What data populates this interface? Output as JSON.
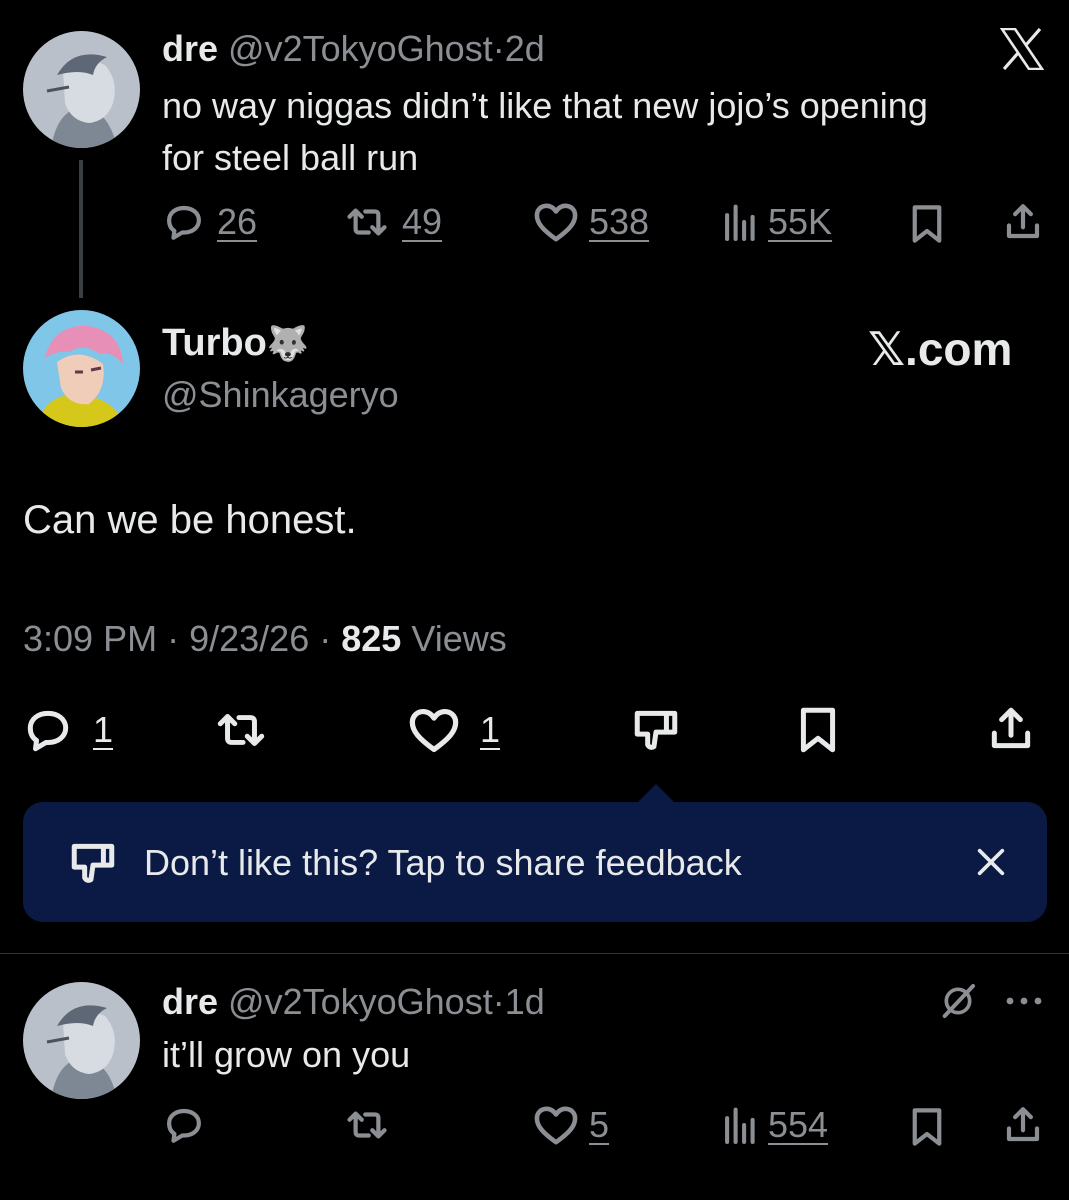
{
  "quoted_post": {
    "author_name": "dre",
    "handle": "@v2TokyoGhost",
    "separator": "·",
    "age": "2d",
    "text_line1": "no way niggas didn’t like that new jojo’s opening",
    "text_line2": "for steel ball run",
    "replies": "26",
    "reposts": "49",
    "likes": "538",
    "views": "55K",
    "platform_logo": "X"
  },
  "main_post": {
    "author_name": "Turbo",
    "author_emoji": "🐺",
    "handle": "@Shinkageryo",
    "watermark": "𝕏.com",
    "text": "Can we be honest.",
    "time": "3:09 PM",
    "date": "9/23/26",
    "dot": "·",
    "views_count": "825",
    "views_label": "Views",
    "replies": "1",
    "likes": "1"
  },
  "feedback_banner": {
    "text": "Don’t like this? Tap to share feedback",
    "bg_color": "#0b1a45",
    "close_icon": "x-icon"
  },
  "reply_post": {
    "author_name": "dre",
    "handle": "@v2TokyoGhost",
    "separator": "·",
    "age": "1d",
    "text": "it’ll grow on you",
    "likes": "5",
    "views": "554",
    "more_icon": "ellipsis-icon",
    "grok_icon": "grok-icon"
  }
}
